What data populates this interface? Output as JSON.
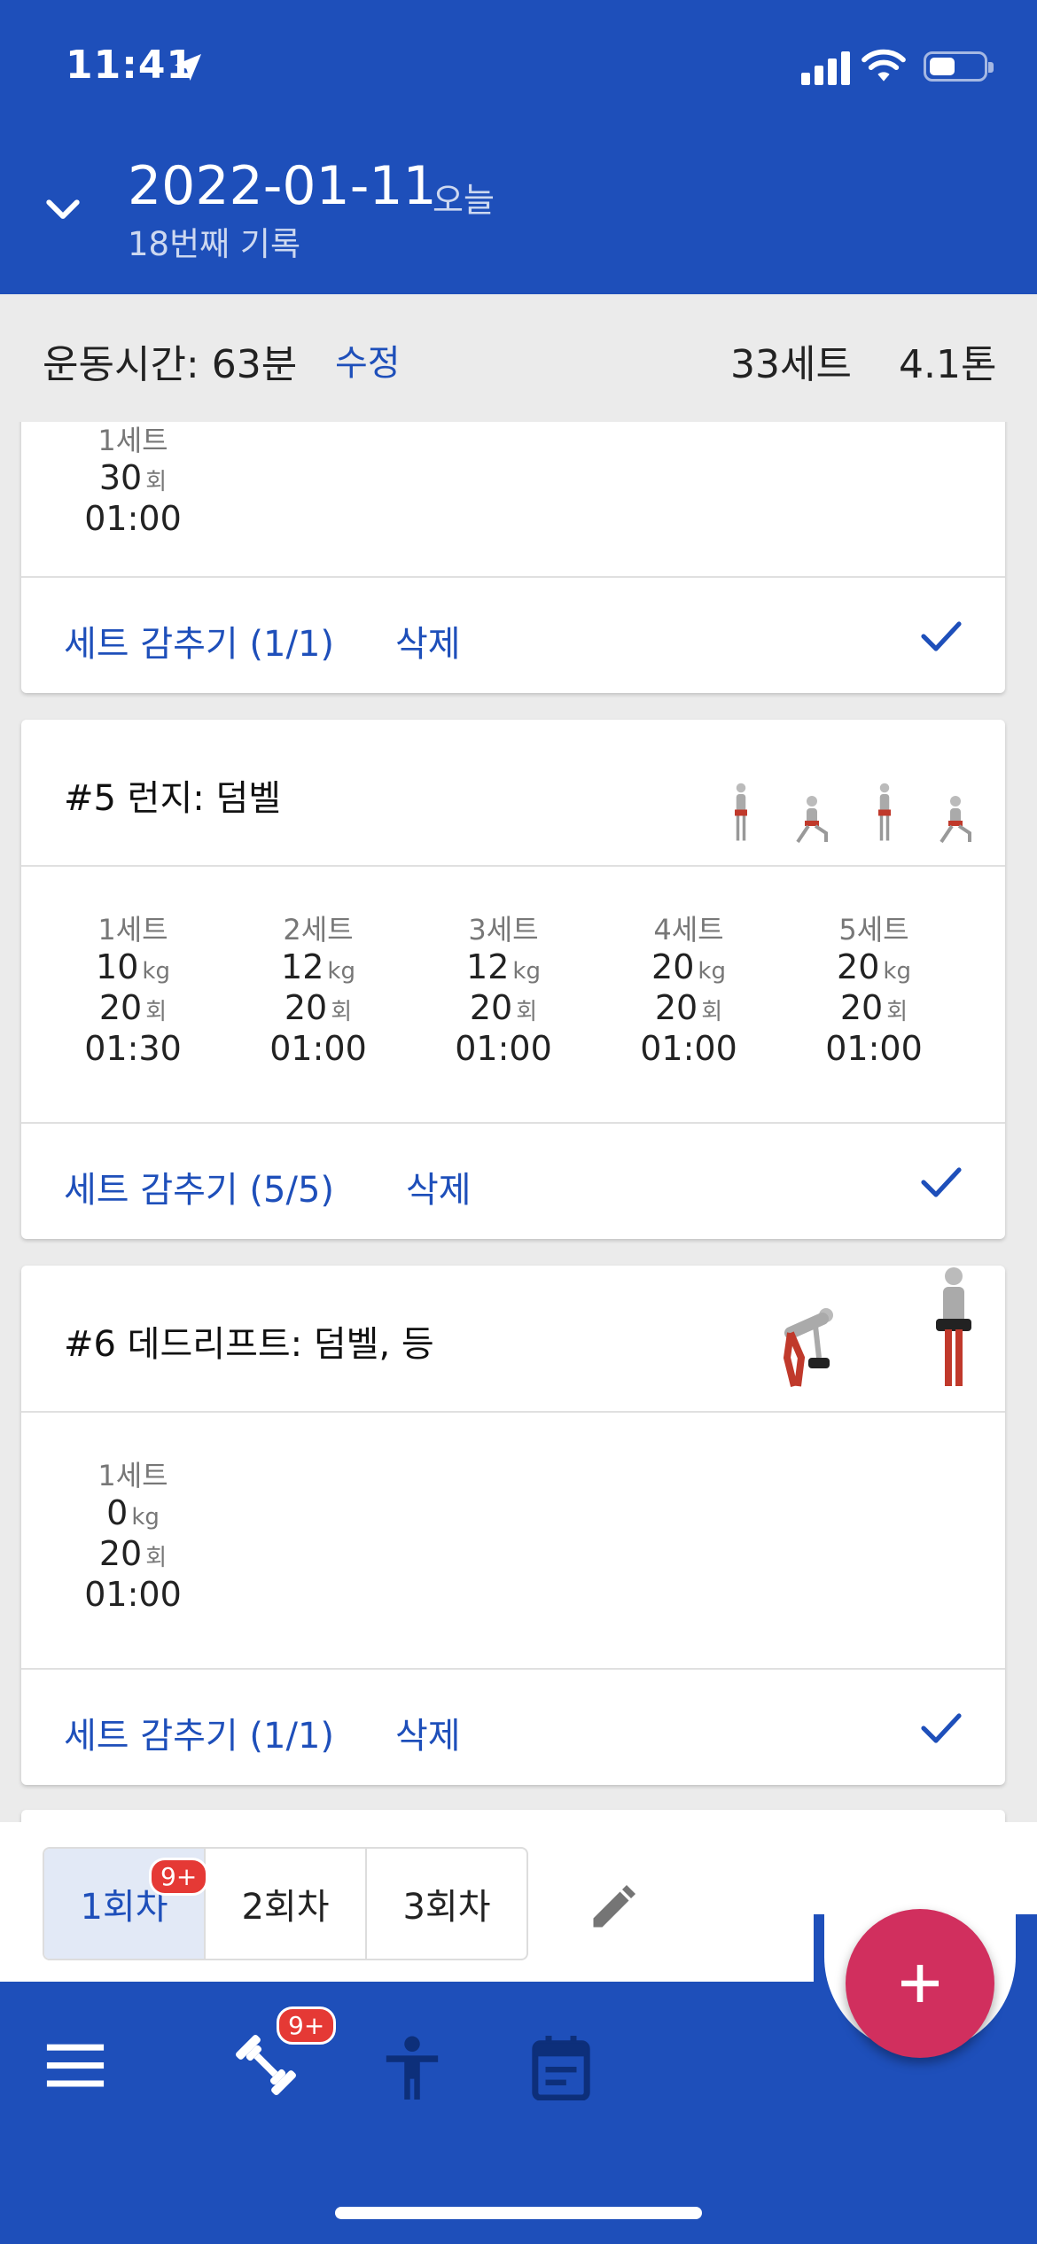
{
  "status_bar": {
    "time": "11:41"
  },
  "header": {
    "date": "2022-01-11",
    "today": "오늘",
    "record_no": "18번째 기록"
  },
  "summary": {
    "duration_label": "운동시간: 63분",
    "edit": "수정",
    "sets": "33세트",
    "tonnage": "4.1톤"
  },
  "cards": [
    {
      "sets": [
        {
          "label": "1세트",
          "reps": "30",
          "reps_unit": "회",
          "time": "01:00"
        }
      ],
      "hide_label": "세트 감추기 (1/1)",
      "delete_label": "삭제"
    },
    {
      "title": "#5 런지: 덤벨",
      "sets": [
        {
          "label": "1세트",
          "weight": "10",
          "weight_unit": "kg",
          "reps": "20",
          "reps_unit": "회",
          "time": "01:30"
        },
        {
          "label": "2세트",
          "weight": "12",
          "weight_unit": "kg",
          "reps": "20",
          "reps_unit": "회",
          "time": "01:00"
        },
        {
          "label": "3세트",
          "weight": "12",
          "weight_unit": "kg",
          "reps": "20",
          "reps_unit": "회",
          "time": "01:00"
        },
        {
          "label": "4세트",
          "weight": "20",
          "weight_unit": "kg",
          "reps": "20",
          "reps_unit": "회",
          "time": "01:00"
        },
        {
          "label": "5세트",
          "weight": "20",
          "weight_unit": "kg",
          "reps": "20",
          "reps_unit": "회",
          "time": "01:00"
        }
      ],
      "hide_label": "세트 감추기 (5/5)",
      "delete_label": "삭제"
    },
    {
      "title": "#6 데드리프트: 덤벨, 등",
      "sets": [
        {
          "label": "1세트",
          "weight": "0",
          "weight_unit": "kg",
          "reps": "20",
          "reps_unit": "회",
          "time": "01:00"
        }
      ],
      "hide_label": "세트 감추기 (1/1)",
      "delete_label": "삭제"
    }
  ],
  "session_tabs": [
    {
      "label": "1회차",
      "badge": "9+"
    },
    {
      "label": "2회차"
    },
    {
      "label": "3회차"
    }
  ],
  "bottom_nav": {
    "workout_badge": "9+"
  },
  "colors": {
    "primary": "#1e4fba",
    "fab": "#d12f5e",
    "badge": "#e53935"
  }
}
